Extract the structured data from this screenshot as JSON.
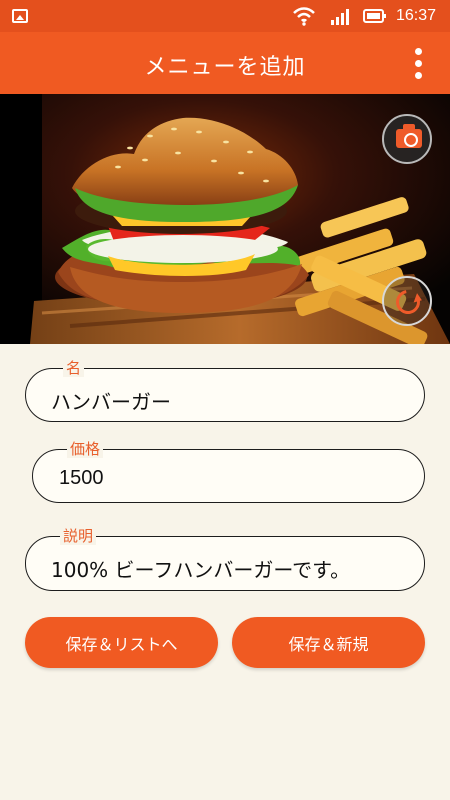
{
  "status_bar": {
    "time": "16:37",
    "icons": [
      "image-notification-icon",
      "wifi-icon",
      "cellular-signal-icon",
      "battery-icon"
    ]
  },
  "app_bar": {
    "title": "メニューを追加",
    "menu_icon": "overflow-menu-icon"
  },
  "photo": {
    "subject": "hamburger and fries",
    "camera_icon": "camera-icon",
    "rotate_icon": "rotate-icon"
  },
  "form": {
    "name": {
      "label": "名",
      "value": "ハンバーガー"
    },
    "price": {
      "label": "価格",
      "value": "1500"
    },
    "description": {
      "label": "説明",
      "value": "100% ビーフハンバーガーです。"
    }
  },
  "actions": {
    "save_list": "保存＆リストへ",
    "save_new": "保存＆新規"
  },
  "colors": {
    "accent": "#f05a22",
    "status_bar": "#e4501d",
    "background": "#f8f4e9",
    "label": "#e85f2c"
  }
}
